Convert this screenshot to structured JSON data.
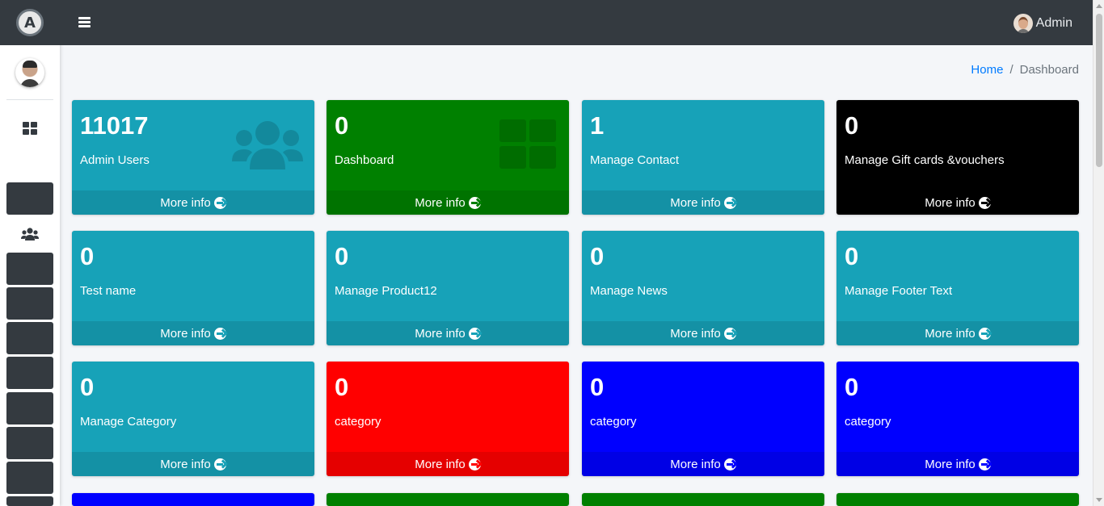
{
  "navbar": {
    "user_name": "Admin",
    "menu_icon": "hamburger-icon"
  },
  "sidebar": {
    "logo_letter": "A",
    "items": [
      {
        "icon": "dashboard-icon"
      },
      {
        "icon": "users-icon"
      }
    ]
  },
  "breadcrumb": {
    "home": "Home",
    "separator": "/",
    "current": "Dashboard"
  },
  "colors": {
    "teal": "#17a2b8",
    "green": "#008000",
    "black": "#000000",
    "red": "#ff0000",
    "blue": "#0000ff",
    "navbar": "#343a40"
  },
  "cards": [
    {
      "count": "11017",
      "title": "Admin Users",
      "footer": "More info",
      "color": "teal",
      "icon": "users-icon"
    },
    {
      "count": "0",
      "title": "Dashboard",
      "footer": "More info",
      "color": "green",
      "icon": "dashboard-icon"
    },
    {
      "count": "1",
      "title": "Manage Contact",
      "footer": "More info",
      "color": "teal"
    },
    {
      "count": "0",
      "title": "Manage Gift cards &vouchers",
      "footer": "More info",
      "color": "black"
    },
    {
      "count": "0",
      "title": "Test name",
      "footer": "More info",
      "color": "teal"
    },
    {
      "count": "0",
      "title": "Manage Product12",
      "footer": "More info",
      "color": "teal"
    },
    {
      "count": "0",
      "title": "Manage News",
      "footer": "More info",
      "color": "teal"
    },
    {
      "count": "0",
      "title": "Manage Footer Text",
      "footer": "More info",
      "color": "teal"
    },
    {
      "count": "0",
      "title": "Manage Category",
      "footer": "More info",
      "color": "teal"
    },
    {
      "count": "0",
      "title": "category",
      "footer": "More info",
      "color": "red"
    },
    {
      "count": "0",
      "title": "category",
      "footer": "More info",
      "color": "blue"
    },
    {
      "count": "0",
      "title": "category",
      "footer": "More info",
      "color": "blue"
    }
  ]
}
